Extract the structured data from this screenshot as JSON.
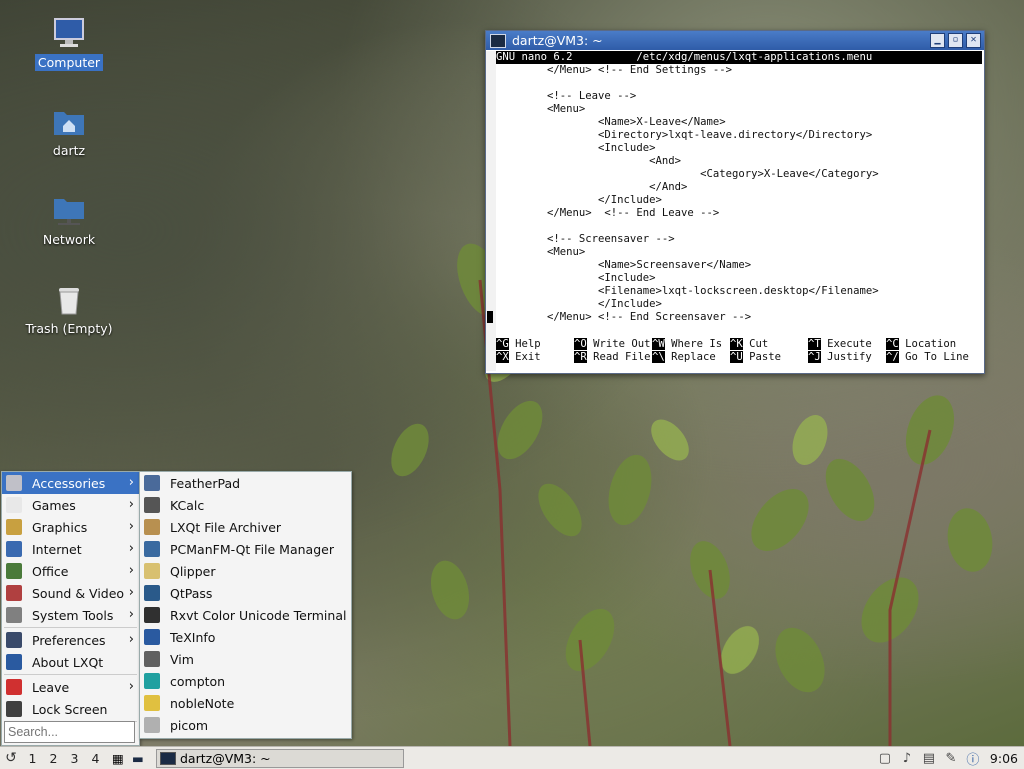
{
  "desktop": {
    "icons": [
      {
        "label": "Computer"
      },
      {
        "label": "dartz"
      },
      {
        "label": "Network"
      },
      {
        "label": "Trash (Empty)"
      }
    ]
  },
  "terminal": {
    "title": "dartz@VM3: ~",
    "header_left": "GNU nano 6.2",
    "header_file": "/etc/xdg/menus/lxqt-applications.menu",
    "lines": [
      "        </Menu> <!-- End Settings -->",
      "",
      "        <!-- Leave -->",
      "        <Menu>",
      "                <Name>X-Leave</Name>",
      "                <Directory>lxqt-leave.directory</Directory>",
      "                <Include>",
      "                        <And>",
      "                                <Category>X-Leave</Category>",
      "                        </And>",
      "                </Include>",
      "        </Menu>  <!-- End Leave -->",
      "",
      "        <!-- Screensaver -->",
      "        <Menu>",
      "                <Name>Screensaver</Name>",
      "                <Include>",
      "                <Filename>lxqt-lockscreen.desktop</Filename>",
      "                </Include>",
      "        </Menu> <!-- End Screensaver -->"
    ],
    "shortcuts_row1": [
      {
        "key": "^G",
        "label": "Help"
      },
      {
        "key": "^O",
        "label": "Write Out"
      },
      {
        "key": "^W",
        "label": "Where Is"
      },
      {
        "key": "^K",
        "label": "Cut"
      },
      {
        "key": "^T",
        "label": "Execute"
      },
      {
        "key": "^C",
        "label": "Location"
      }
    ],
    "shortcuts_row2": [
      {
        "key": "^X",
        "label": "Exit"
      },
      {
        "key": "^R",
        "label": "Read File"
      },
      {
        "key": "^\\",
        "label": "Replace"
      },
      {
        "key": "^U",
        "label": "Paste"
      },
      {
        "key": "^J",
        "label": "Justify"
      },
      {
        "key": "^/",
        "label": "Go To Line"
      }
    ]
  },
  "menu": {
    "items": [
      {
        "label": "Accessories",
        "icon": "accessories-icon",
        "color": "#c0c0c8",
        "submenu": true
      },
      {
        "label": "Games",
        "icon": "games-icon",
        "color": "#e8e8e8",
        "submenu": true
      },
      {
        "label": "Graphics",
        "icon": "graphics-icon",
        "color": "#c8a040",
        "submenu": true
      },
      {
        "label": "Internet",
        "icon": "internet-icon",
        "color": "#3a6ab0",
        "submenu": true
      },
      {
        "label": "Office",
        "icon": "office-icon",
        "color": "#4a7a3a",
        "submenu": true
      },
      {
        "label": "Sound & Video",
        "icon": "sound-video-icon",
        "color": "#b04040",
        "submenu": true
      },
      {
        "label": "System Tools",
        "icon": "system-tools-icon",
        "color": "#808080",
        "submenu": true
      },
      {
        "label": "Preferences",
        "icon": "preferences-icon",
        "color": "#3a4a6a",
        "submenu": true
      },
      {
        "label": "About LXQt",
        "icon": "about-icon",
        "color": "#2a5aa0",
        "submenu": false
      },
      {
        "label": "Leave",
        "icon": "leave-icon",
        "color": "#d03030",
        "submenu": true
      },
      {
        "label": "Lock Screen",
        "icon": "lock-screen-icon",
        "color": "#404040",
        "submenu": false
      }
    ],
    "search_placeholder": "Search..."
  },
  "submenu": {
    "items": [
      {
        "label": "FeatherPad",
        "icon": "featherpad-icon",
        "color": "#4a6a9a"
      },
      {
        "label": "KCalc",
        "icon": "kcalc-icon",
        "color": "#555555"
      },
      {
        "label": "LXQt File Archiver",
        "icon": "archiver-icon",
        "color": "#b89050"
      },
      {
        "label": "PCManFM-Qt File Manager",
        "icon": "file-manager-icon",
        "color": "#3a6aa0"
      },
      {
        "label": "Qlipper",
        "icon": "qlipper-icon",
        "color": "#d8c070"
      },
      {
        "label": "QtPass",
        "icon": "qtpass-icon",
        "color": "#2a5a8a"
      },
      {
        "label": "Rxvt Color Unicode Terminal",
        "icon": "terminal-icon",
        "color": "#303030"
      },
      {
        "label": "TeXInfo",
        "icon": "texinfo-icon",
        "color": "#2a5aa0"
      },
      {
        "label": "Vim",
        "icon": "vim-icon",
        "color": "#606060"
      },
      {
        "label": "compton",
        "icon": "compton-icon",
        "color": "#20a0a0"
      },
      {
        "label": "nobleNote",
        "icon": "noblenote-icon",
        "color": "#e0c040"
      },
      {
        "label": "picom",
        "icon": "picom-icon",
        "color": "#b0b0b0"
      }
    ]
  },
  "taskbar": {
    "desktops": [
      "1",
      "2",
      "3",
      "4"
    ],
    "task_title": "dartz@VM3: ~",
    "clock": "9:06"
  }
}
